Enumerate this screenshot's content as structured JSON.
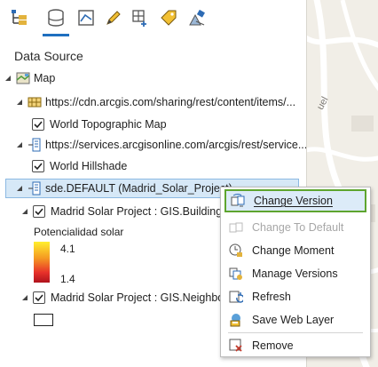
{
  "toolbar": {
    "icons": [
      "list-by-drawing-order-icon",
      "list-by-data-source-icon",
      "list-by-selection-icon",
      "list-by-editing-icon",
      "list-by-snapping-icon",
      "list-by-labeling-icon",
      "list-by-perspective-imagery-icon"
    ],
    "active_tab": "list-by-data-source-icon"
  },
  "pane": {
    "heading": "Data Source"
  },
  "tree": {
    "map": "Map",
    "source1": "https://cdn.arcgis.com/sharing/rest/content/items/...",
    "layer1": "World Topographic Map",
    "source2": "https://services.arcgisonline.com/arcgis/rest/service...",
    "layer2": "World Hillshade",
    "source3": "sde.DEFAULT (Madrid_Solar_Project)",
    "layer3": "Madrid Solar Project : GIS.Buildings",
    "legend_title": "Potencialidad solar",
    "legend_max": "4.1",
    "legend_min": "1.4",
    "layer4": "Madrid Solar Project : GIS.Neighborh"
  },
  "map": {
    "street_label": "uel"
  },
  "menu": {
    "items": [
      {
        "label": "Change Version",
        "icon": "change-version-icon",
        "enabled": true,
        "highlighted": true
      },
      {
        "label": "Change To Default",
        "icon": "change-to-default-icon",
        "enabled": false
      },
      {
        "label": "Change Moment",
        "icon": "change-moment-icon",
        "enabled": true
      },
      {
        "label": "Manage Versions",
        "icon": "manage-versions-icon",
        "enabled": true
      },
      {
        "label": "Refresh",
        "icon": "refresh-icon",
        "enabled": true
      },
      {
        "label": "Save Web Layer",
        "icon": "save-web-layer-icon",
        "enabled": true
      },
      {
        "label": "Remove",
        "icon": "remove-icon",
        "enabled": true
      }
    ]
  },
  "colors": {
    "highlight_border": "#5ea52f",
    "selection_fill": "#d6e8f7",
    "accent": "#1f6fbf"
  }
}
